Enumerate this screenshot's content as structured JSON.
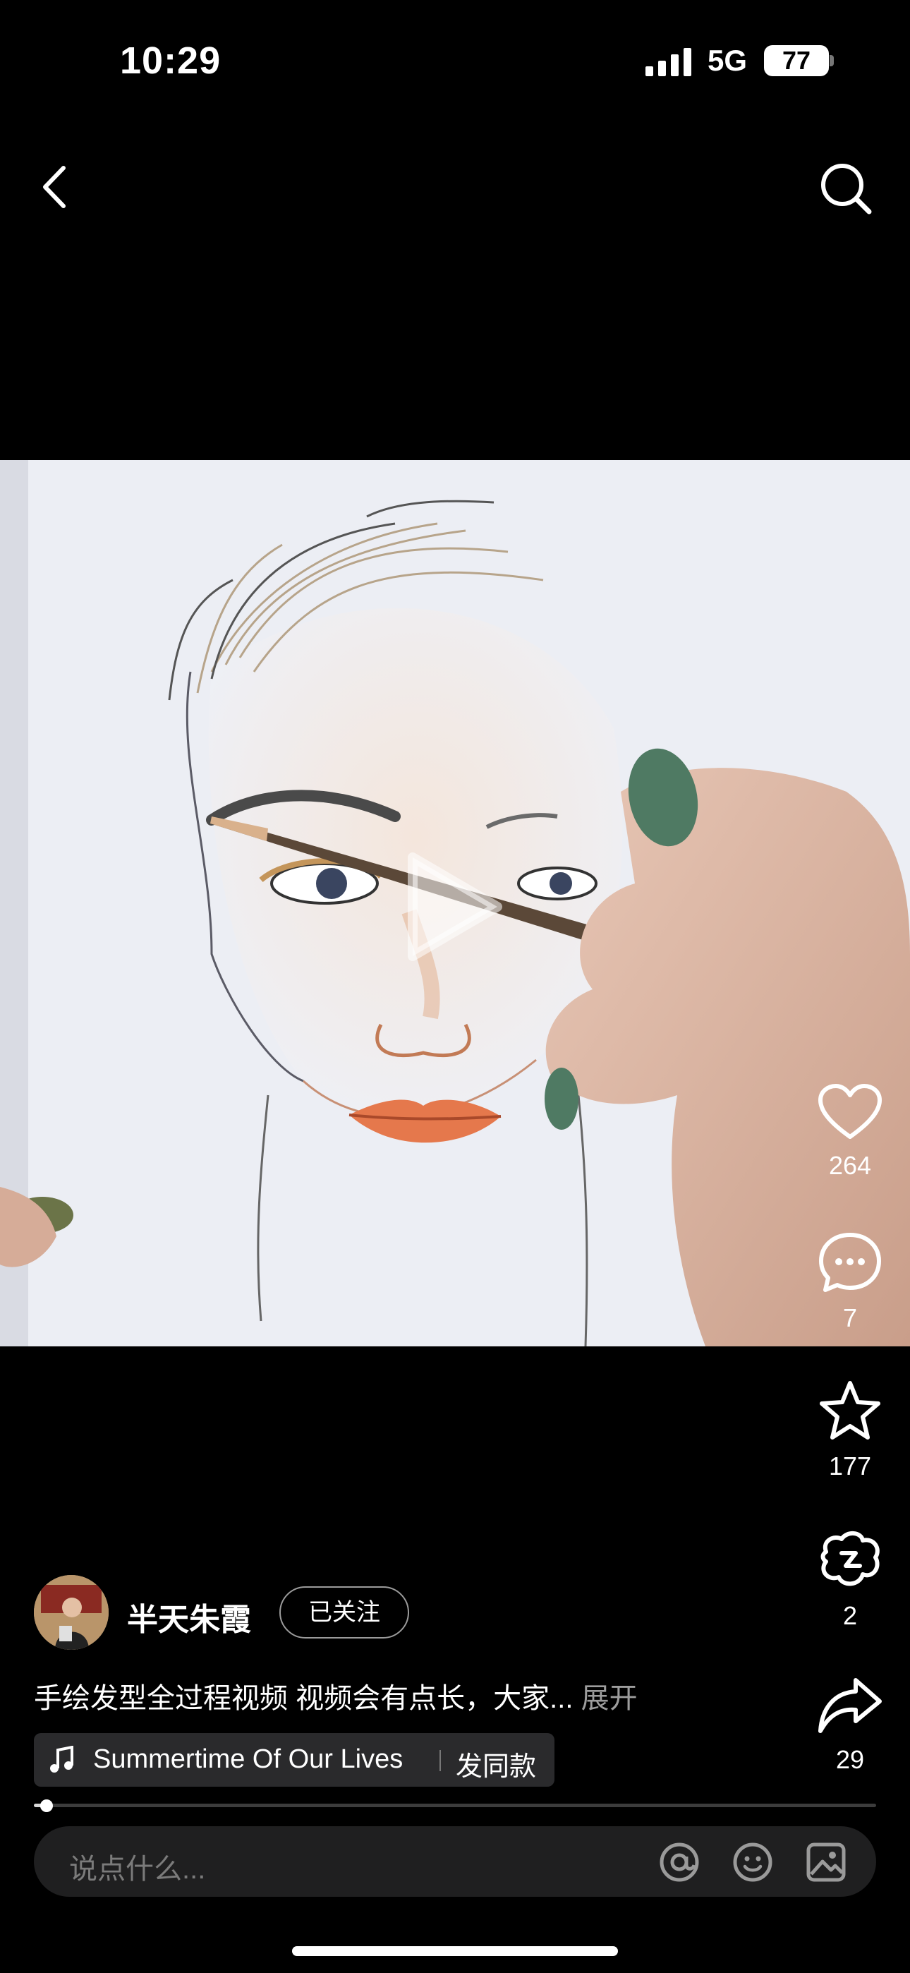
{
  "status_bar": {
    "time": "10:29",
    "network": "5G",
    "battery": "77"
  },
  "actions": [
    {
      "name": "like",
      "count": "264"
    },
    {
      "name": "comment",
      "count": "7"
    },
    {
      "name": "favorite",
      "count": "177"
    },
    {
      "name": "share-circle",
      "count": "2"
    },
    {
      "name": "share",
      "count": "29"
    }
  ],
  "author": {
    "name": "半天朱霞",
    "follow_label": "已关注"
  },
  "description": {
    "text": "手绘发型全过程视频 视频会有点长，大家...",
    "more": "展开"
  },
  "music": {
    "title": "Summertime Of Our Lives",
    "same_label": "发同款"
  },
  "playback": {
    "progress": 0.015
  },
  "comment_input": {
    "placeholder": "说点什么..."
  },
  "icons": [
    "back-icon",
    "search-icon",
    "play-icon",
    "heart-icon",
    "comment-icon",
    "star-icon",
    "share-circle-icon",
    "share-icon",
    "music-note-icon",
    "at-icon",
    "emoji-icon",
    "image-icon"
  ]
}
